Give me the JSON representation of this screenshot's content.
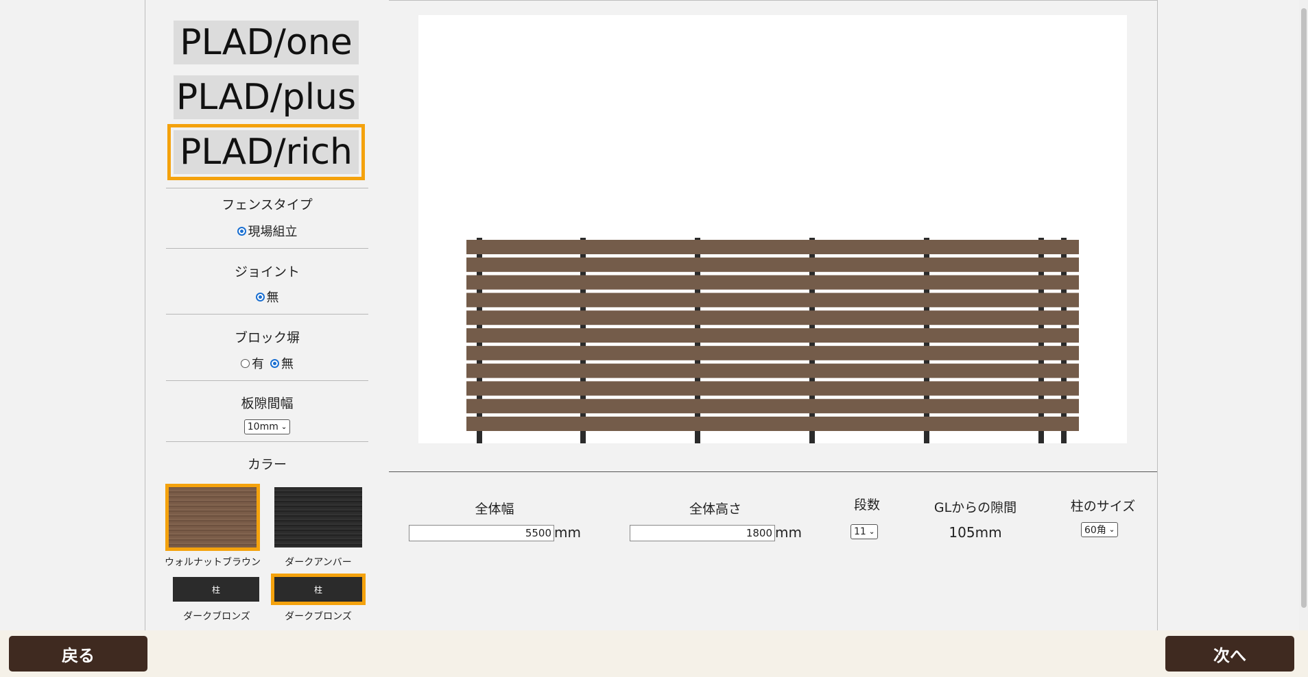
{
  "products": [
    "PLAD/one",
    "PLAD/plus",
    "PLAD/rich"
  ],
  "selected_product": "PLAD/rich",
  "fence_type": {
    "title": "フェンスタイプ",
    "option": "現場組立"
  },
  "joint": {
    "title": "ジョイント",
    "option": "無"
  },
  "block_wall": {
    "title": "ブロック塀",
    "option_yes": "有",
    "option_no": "無",
    "selected": "無"
  },
  "board_gap": {
    "title": "板隙間幅",
    "value": "10mm"
  },
  "color": {
    "title": "カラー",
    "board_colors": [
      {
        "name": "ウォルナットブラウン",
        "hex": "#7a5c48",
        "selected": true
      },
      {
        "name": "ダークアンバー",
        "hex": "#2c2c2c",
        "selected": false
      }
    ],
    "post_colors": [
      {
        "glyph": "柱",
        "name": "ダークブロンズ",
        "selected": false
      },
      {
        "glyph": "柱",
        "name": "ダークブロンズ",
        "selected": true
      }
    ]
  },
  "dimensions": {
    "width_label": "全体幅",
    "width_value": "5500",
    "height_label": "全体高さ",
    "height_value": "1800",
    "unit": "mm",
    "rows_label": "段数",
    "rows_value": "11",
    "gl_gap_label": "GLからの隙間",
    "gl_gap_value": "105mm",
    "post_size_label": "柱のサイズ",
    "post_size_value": "60角"
  },
  "fence_preview": {
    "board_count": 11,
    "post_count": 7,
    "board_color": "#745c4a",
    "post_color": "#2b2b2b"
  },
  "nav": {
    "back": "戻る",
    "next": "次へ"
  },
  "colors": {
    "accent": "#f4a20d",
    "nav_button": "#3f2a20",
    "footer": "#f5f1e8"
  }
}
